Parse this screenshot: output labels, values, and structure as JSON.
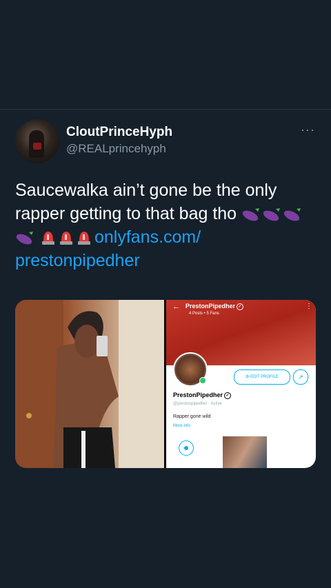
{
  "tweet": {
    "display_name": "CloutPrinceHyph",
    "handle": "@REALprincehyph",
    "text_line1": "Saucewalka ain’t gone be the only",
    "text_line2": "rapper getting to that bag tho",
    "link_part1": "onlyfans.com/",
    "link_part2": "prestonpipedher",
    "more_icon": "more-horizontal-icon",
    "link_color": "#1da1f2"
  },
  "embedded_profile": {
    "title": "PrestonPipedher",
    "stats": "4 Posts • 5 Fans",
    "edit_button": "EDIT PROFILE",
    "name": "PrestonPipedher",
    "handle_status": "@prestonpipedher · Active",
    "bio": "Rapper gone wild",
    "more_info": "More info"
  },
  "colors": {
    "background": "#15202b",
    "secondary_text": "#8899a6",
    "onlyfans_accent": "#00aff0"
  }
}
